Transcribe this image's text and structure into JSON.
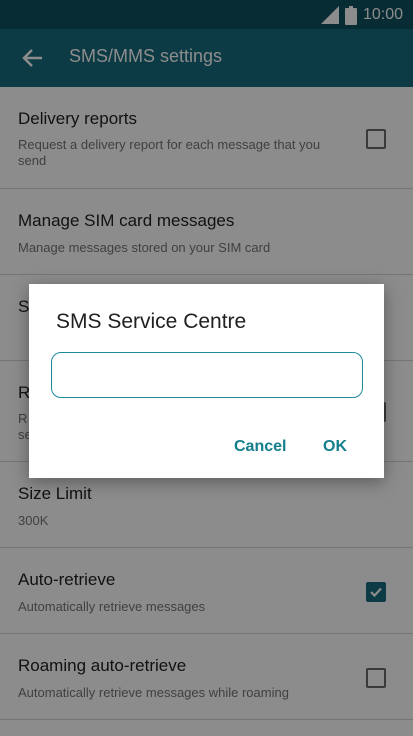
{
  "status_bar": {
    "time": "10:00"
  },
  "app_bar": {
    "title": "SMS/MMS settings"
  },
  "settings": [
    {
      "title": "Delivery reports",
      "subtitle": "Request a delivery report for each message that you send",
      "checked": false
    },
    {
      "title": "Manage SIM card messages",
      "subtitle": "Manage messages stored on your SIM card"
    },
    {
      "title": "S",
      "subtitle": ""
    },
    {
      "title": "R",
      "subtitle_line1": "R",
      "subtitle_line2": "se"
    },
    {
      "title": "Size Limit",
      "subtitle": "300K"
    },
    {
      "title": "Auto-retrieve",
      "subtitle": "Automatically retrieve messages",
      "checked": true
    },
    {
      "title": "Roaming auto-retrieve",
      "subtitle": "Automatically retrieve messages while roaming",
      "checked": false
    }
  ],
  "dialog": {
    "title": "SMS Service Centre",
    "input_value": "",
    "cancel_label": "Cancel",
    "ok_label": "OK"
  },
  "colors": {
    "status_bar": "#0f5060",
    "app_bar": "#176b7e",
    "accent": "#137e8c"
  }
}
